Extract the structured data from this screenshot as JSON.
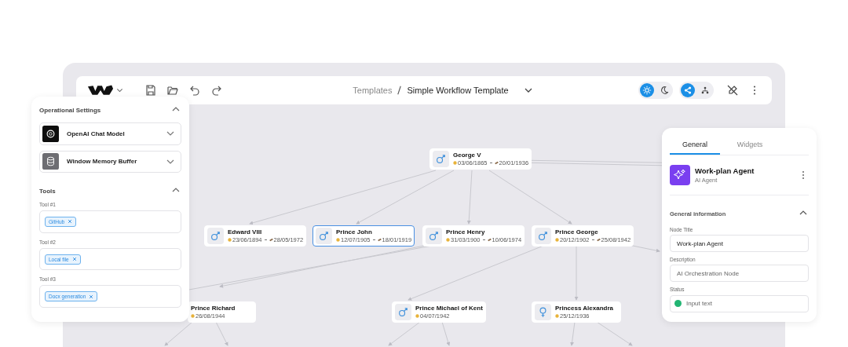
{
  "toolbar": {
    "breadcrumb": [
      "Templates",
      "Simple Workflow Template"
    ],
    "theme_toggle": [
      {
        "kind": "light",
        "selected": true
      },
      {
        "kind": "dark",
        "selected": false
      }
    ],
    "view_toggle": [
      {
        "kind": "graph",
        "selected": true
      },
      {
        "kind": "tree",
        "selected": false
      }
    ]
  },
  "settings_panel": {
    "title": "Operational Settings",
    "expanded": true,
    "models": [
      {
        "kind": "openai",
        "label": "OpenAI Chat Model",
        "expanded": false
      },
      {
        "kind": "memory",
        "label": "Window Memory Buffer",
        "expanded": false
      }
    ],
    "tools_title": "Tools",
    "tools_expanded": true,
    "tools": [
      {
        "label": "Tool #1",
        "tags": [
          "GitHub"
        ]
      },
      {
        "label": "Tool #2",
        "tags": [
          "Local file"
        ]
      },
      {
        "label": "Tool #3",
        "tags": [
          "Docx generation"
        ]
      }
    ]
  },
  "canvas": {
    "nodes": [
      {
        "name": "George V",
        "kind": "male",
        "born": "03/06/1865",
        "died": "20/01/1936",
        "selected": false
      },
      {
        "name": "Edward VIII",
        "kind": "male",
        "born": "23/06/1894",
        "died": "28/05/1972",
        "selected": false
      },
      {
        "name": "Prince John",
        "kind": "male",
        "born": "12/07/1905",
        "died": "18/01/1919",
        "selected": true
      },
      {
        "name": "Prince Henry",
        "kind": "male",
        "born": "31/03/1900",
        "died": "10/06/1974",
        "selected": false
      },
      {
        "name": "Prince George",
        "kind": "male",
        "born": "20/12/1902",
        "died": "25/08/1942",
        "selected": false
      },
      {
        "name": "Prince Richard",
        "born": "26/08/1944",
        "selected": false
      },
      {
        "name": "Prince Michael of Kent",
        "kind": "male",
        "born": "04/07/1942",
        "selected": false
      },
      {
        "name": "Princess Alexandra",
        "kind": "female",
        "born": "25/12/1936",
        "selected": false
      }
    ]
  },
  "inspector": {
    "tabs": [
      {
        "label": "General",
        "selected": true
      },
      {
        "label": "Widgets",
        "selected": false
      }
    ],
    "agent": {
      "name": "Work-plan Agent",
      "type": "AI Agent"
    },
    "section": {
      "title": "General information",
      "expanded": true
    },
    "fields": [
      {
        "kind": "text",
        "label": "Node Title",
        "value": "Work-plan Agent"
      },
      {
        "kind": "text",
        "label": "Description",
        "placeholder": "AI Orchestration Node"
      },
      {
        "kind": "status",
        "label": "Status",
        "placeholder": "Input text",
        "color": "#22b573"
      }
    ]
  }
}
